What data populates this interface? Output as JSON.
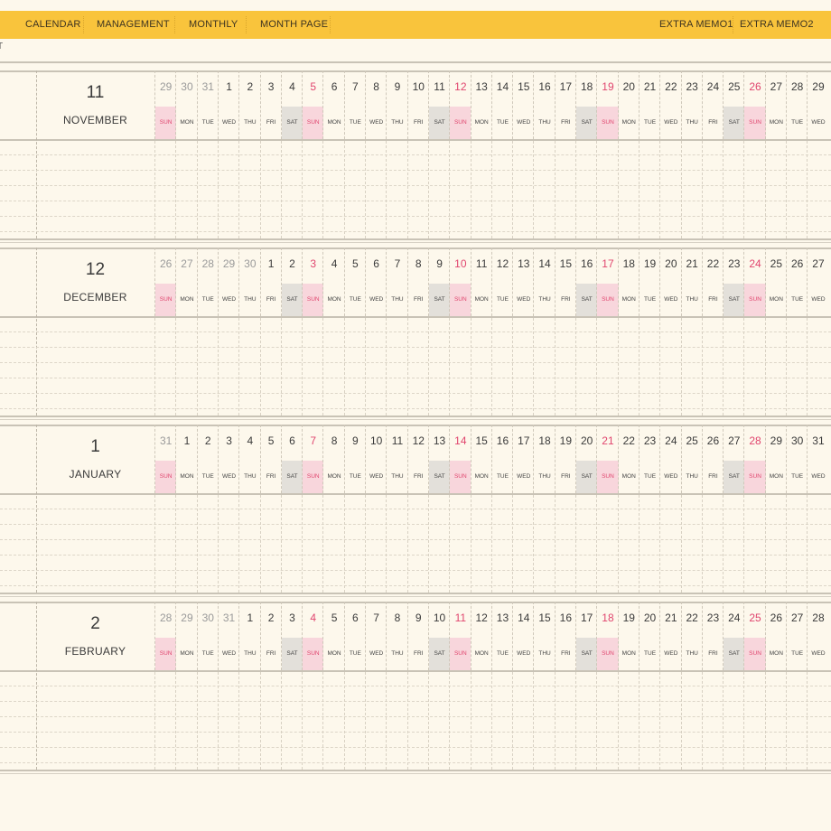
{
  "nav": {
    "items": [
      {
        "label": "CALENDAR"
      },
      {
        "label": "MANAGEMENT"
      },
      {
        "label": "MONTHLY"
      },
      {
        "label": "MONTH PAGE"
      },
      {
        "label": "EXTRA MEMO1"
      },
      {
        "label": "EXTRA MEMO2"
      }
    ]
  },
  "breadcrumb": "T",
  "colors": {
    "topbar": "#f9c43c",
    "background": "#fdf8ec",
    "sunday": "#e0456e",
    "sunday_bg": "#f8d6dc",
    "saturday_bg": "#e3e0da"
  },
  "months": [
    {
      "number": "11",
      "name": "NOVEMBER",
      "days": [
        {
          "n": "29",
          "w": "SUN",
          "prev": true
        },
        {
          "n": "30",
          "w": "MON",
          "prev": true
        },
        {
          "n": "31",
          "w": "TUE",
          "prev": true
        },
        {
          "n": "1",
          "w": "WED"
        },
        {
          "n": "2",
          "w": "THU"
        },
        {
          "n": "3",
          "w": "FRI"
        },
        {
          "n": "4",
          "w": "SAT"
        },
        {
          "n": "5",
          "w": "SUN"
        },
        {
          "n": "6",
          "w": "MON"
        },
        {
          "n": "7",
          "w": "TUE"
        },
        {
          "n": "8",
          "w": "WED"
        },
        {
          "n": "9",
          "w": "THU"
        },
        {
          "n": "10",
          "w": "FRI"
        },
        {
          "n": "11",
          "w": "SAT"
        },
        {
          "n": "12",
          "w": "SUN"
        },
        {
          "n": "13",
          "w": "MON"
        },
        {
          "n": "14",
          "w": "TUE"
        },
        {
          "n": "15",
          "w": "WED"
        },
        {
          "n": "16",
          "w": "THU"
        },
        {
          "n": "17",
          "w": "FRI"
        },
        {
          "n": "18",
          "w": "SAT"
        },
        {
          "n": "19",
          "w": "SUN"
        },
        {
          "n": "20",
          "w": "MON"
        },
        {
          "n": "21",
          "w": "TUE"
        },
        {
          "n": "22",
          "w": "WED"
        },
        {
          "n": "23",
          "w": "THU"
        },
        {
          "n": "24",
          "w": "FRI"
        },
        {
          "n": "25",
          "w": "SAT"
        },
        {
          "n": "26",
          "w": "SUN"
        },
        {
          "n": "27",
          "w": "MON"
        },
        {
          "n": "28",
          "w": "TUE"
        },
        {
          "n": "29",
          "w": "WED"
        }
      ]
    },
    {
      "number": "12",
      "name": "DECEMBER",
      "days": [
        {
          "n": "26",
          "w": "SUN",
          "prev": true
        },
        {
          "n": "27",
          "w": "MON",
          "prev": true
        },
        {
          "n": "28",
          "w": "TUE",
          "prev": true
        },
        {
          "n": "29",
          "w": "WED",
          "prev": true
        },
        {
          "n": "30",
          "w": "THU",
          "prev": true
        },
        {
          "n": "1",
          "w": "FRI"
        },
        {
          "n": "2",
          "w": "SAT"
        },
        {
          "n": "3",
          "w": "SUN"
        },
        {
          "n": "4",
          "w": "MON"
        },
        {
          "n": "5",
          "w": "TUE"
        },
        {
          "n": "6",
          "w": "WED"
        },
        {
          "n": "7",
          "w": "THU"
        },
        {
          "n": "8",
          "w": "FRI"
        },
        {
          "n": "9",
          "w": "SAT"
        },
        {
          "n": "10",
          "w": "SUN"
        },
        {
          "n": "11",
          "w": "MON"
        },
        {
          "n": "12",
          "w": "TUE"
        },
        {
          "n": "13",
          "w": "WED"
        },
        {
          "n": "14",
          "w": "THU"
        },
        {
          "n": "15",
          "w": "FRI"
        },
        {
          "n": "16",
          "w": "SAT"
        },
        {
          "n": "17",
          "w": "SUN"
        },
        {
          "n": "18",
          "w": "MON"
        },
        {
          "n": "19",
          "w": "TUE"
        },
        {
          "n": "20",
          "w": "WED"
        },
        {
          "n": "21",
          "w": "THU"
        },
        {
          "n": "22",
          "w": "FRI"
        },
        {
          "n": "23",
          "w": "SAT"
        },
        {
          "n": "24",
          "w": "SUN"
        },
        {
          "n": "25",
          "w": "MON"
        },
        {
          "n": "26",
          "w": "TUE"
        },
        {
          "n": "27",
          "w": "WED"
        }
      ]
    },
    {
      "number": "1",
      "name": "JANUARY",
      "days": [
        {
          "n": "31",
          "w": "SUN",
          "prev": true
        },
        {
          "n": "1",
          "w": "MON"
        },
        {
          "n": "2",
          "w": "TUE"
        },
        {
          "n": "3",
          "w": "WED"
        },
        {
          "n": "4",
          "w": "THU"
        },
        {
          "n": "5",
          "w": "FRI"
        },
        {
          "n": "6",
          "w": "SAT"
        },
        {
          "n": "7",
          "w": "SUN"
        },
        {
          "n": "8",
          "w": "MON"
        },
        {
          "n": "9",
          "w": "TUE"
        },
        {
          "n": "10",
          "w": "WED"
        },
        {
          "n": "11",
          "w": "THU"
        },
        {
          "n": "12",
          "w": "FRI"
        },
        {
          "n": "13",
          "w": "SAT"
        },
        {
          "n": "14",
          "w": "SUN"
        },
        {
          "n": "15",
          "w": "MON"
        },
        {
          "n": "16",
          "w": "TUE"
        },
        {
          "n": "17",
          "w": "WED"
        },
        {
          "n": "18",
          "w": "THU"
        },
        {
          "n": "19",
          "w": "FRI"
        },
        {
          "n": "20",
          "w": "SAT"
        },
        {
          "n": "21",
          "w": "SUN"
        },
        {
          "n": "22",
          "w": "MON"
        },
        {
          "n": "23",
          "w": "TUE"
        },
        {
          "n": "24",
          "w": "WED"
        },
        {
          "n": "25",
          "w": "THU"
        },
        {
          "n": "26",
          "w": "FRI"
        },
        {
          "n": "27",
          "w": "SAT"
        },
        {
          "n": "28",
          "w": "SUN"
        },
        {
          "n": "29",
          "w": "MON"
        },
        {
          "n": "30",
          "w": "TUE"
        },
        {
          "n": "31",
          "w": "WED"
        }
      ]
    },
    {
      "number": "2",
      "name": "FEBRUARY",
      "days": [
        {
          "n": "28",
          "w": "SUN",
          "prev": true
        },
        {
          "n": "29",
          "w": "MON",
          "prev": true
        },
        {
          "n": "30",
          "w": "TUE",
          "prev": true
        },
        {
          "n": "31",
          "w": "WED",
          "prev": true
        },
        {
          "n": "1",
          "w": "THU"
        },
        {
          "n": "2",
          "w": "FRI"
        },
        {
          "n": "3",
          "w": "SAT"
        },
        {
          "n": "4",
          "w": "SUN"
        },
        {
          "n": "5",
          "w": "MON"
        },
        {
          "n": "6",
          "w": "TUE"
        },
        {
          "n": "7",
          "w": "WED"
        },
        {
          "n": "8",
          "w": "THU"
        },
        {
          "n": "9",
          "w": "FRI"
        },
        {
          "n": "10",
          "w": "SAT"
        },
        {
          "n": "11",
          "w": "SUN"
        },
        {
          "n": "12",
          "w": "MON"
        },
        {
          "n": "13",
          "w": "TUE"
        },
        {
          "n": "14",
          "w": "WED"
        },
        {
          "n": "15",
          "w": "THU"
        },
        {
          "n": "16",
          "w": "FRI"
        },
        {
          "n": "17",
          "w": "SAT"
        },
        {
          "n": "18",
          "w": "SUN"
        },
        {
          "n": "19",
          "w": "MON"
        },
        {
          "n": "20",
          "w": "TUE"
        },
        {
          "n": "21",
          "w": "WED"
        },
        {
          "n": "22",
          "w": "THU"
        },
        {
          "n": "23",
          "w": "FRI"
        },
        {
          "n": "24",
          "w": "SAT"
        },
        {
          "n": "25",
          "w": "SUN"
        },
        {
          "n": "26",
          "w": "MON"
        },
        {
          "n": "27",
          "w": "TUE"
        },
        {
          "n": "28",
          "w": "WED"
        }
      ]
    }
  ]
}
